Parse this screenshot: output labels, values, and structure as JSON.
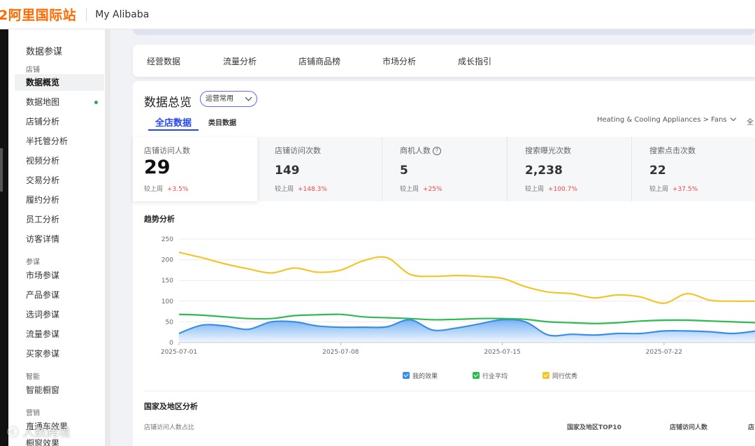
{
  "header": {
    "logo_text": "2阿里国际站",
    "title": "My Alibaba"
  },
  "sidebar": {
    "section_title": "数据参谋",
    "groups": {
      "shop": "店铺",
      "advisor": "参谋",
      "smart": "智能",
      "marketing": "营销"
    },
    "items": [
      {
        "label": "数据概览"
      },
      {
        "label": "数据地图"
      },
      {
        "label": "店铺分析"
      },
      {
        "label": "半托管分析"
      },
      {
        "label": "视频分析"
      },
      {
        "label": "交易分析"
      },
      {
        "label": "履约分析"
      },
      {
        "label": "员工分析"
      },
      {
        "label": "访客详情"
      },
      {
        "label": "市场参谋"
      },
      {
        "label": "产品参谋"
      },
      {
        "label": "选词参谋"
      },
      {
        "label": "流量参谋"
      },
      {
        "label": "买家参谋"
      },
      {
        "label": "智能橱窗"
      },
      {
        "label": "直通车效果"
      },
      {
        "label": "橱窗效果"
      }
    ]
  },
  "nav_tabs": [
    {
      "label": "经营数据"
    },
    {
      "label": "流量分析"
    },
    {
      "label": "店铺商品榜"
    },
    {
      "label": "市场分析"
    },
    {
      "label": "成长指引"
    }
  ],
  "overview": {
    "title": "数据总览",
    "dropdown_value": "运营常用",
    "tab_all": "全店数据",
    "tab_category": "类目数据",
    "category_path": "Heating & Cooling Appliances > Fans",
    "extra_cut": "全"
  },
  "kpis": [
    {
      "name": "店铺访问人数",
      "value": "29",
      "compare_label": "较上周",
      "change": "+3.5%"
    },
    {
      "name": "店铺访问次数",
      "value": "149",
      "compare_label": "较上周",
      "change": "+148.3%"
    },
    {
      "name": "商机人数",
      "value": "5",
      "compare_label": "较上周",
      "change": "+25%"
    },
    {
      "name": "搜索曝光次数",
      "value": "2,238",
      "compare_label": "较上周",
      "change": "+100.7%"
    },
    {
      "name": "搜索点击次数",
      "value": "22",
      "compare_label": "较上周",
      "change": "+37.5%"
    }
  ],
  "trend": {
    "title": "趋势分析"
  },
  "chart_data": {
    "type": "line",
    "x": [
      "2025-07-01",
      "2025-07-02",
      "2025-07-03",
      "2025-07-04",
      "2025-07-05",
      "2025-07-06",
      "2025-07-07",
      "2025-07-08",
      "2025-07-09",
      "2025-07-10",
      "2025-07-11",
      "2025-07-12",
      "2025-07-13",
      "2025-07-14",
      "2025-07-15",
      "2025-07-16",
      "2025-07-17",
      "2025-07-18",
      "2025-07-19",
      "2025-07-20",
      "2025-07-21",
      "2025-07-22",
      "2025-07-23",
      "2025-07-24",
      "2025-07-25",
      "2025-07-26"
    ],
    "x_tick_labels": [
      "2025-07-01",
      "2025-07-08",
      "2025-07-15",
      "2025-07-22"
    ],
    "y_ticks": [
      0,
      50,
      100,
      150,
      200,
      250
    ],
    "ylim": [
      0,
      250
    ],
    "series": [
      {
        "name": "我的效果",
        "color": "#3a8ee6",
        "values": [
          22,
          42,
          40,
          32,
          50,
          50,
          40,
          37,
          37,
          38,
          55,
          30,
          35,
          45,
          55,
          50,
          18,
          20,
          18,
          22,
          22,
          28,
          28,
          26,
          22,
          28
        ]
      },
      {
        "name": "行业平均",
        "color": "#2fba52",
        "values": [
          68,
          66,
          62,
          58,
          58,
          65,
          67,
          68,
          62,
          60,
          58,
          55,
          56,
          58,
          58,
          56,
          50,
          48,
          46,
          48,
          52,
          54,
          54,
          52,
          50,
          48
        ]
      },
      {
        "name": "同行优秀",
        "color": "#f2c62a",
        "values": [
          218,
          205,
          190,
          178,
          168,
          180,
          170,
          175,
          198,
          205,
          165,
          160,
          162,
          160,
          155,
          135,
          122,
          118,
          108,
          115,
          110,
          95,
          118,
          102,
          100,
          100
        ]
      }
    ]
  },
  "region": {
    "title": "国家及地区分析",
    "subtitle": "店铺访问人数占比",
    "col_top10": "国家及地区TOP10",
    "col_visitors": "店铺访问人数",
    "col_cut": "店"
  },
  "watermark": "人数跨境"
}
